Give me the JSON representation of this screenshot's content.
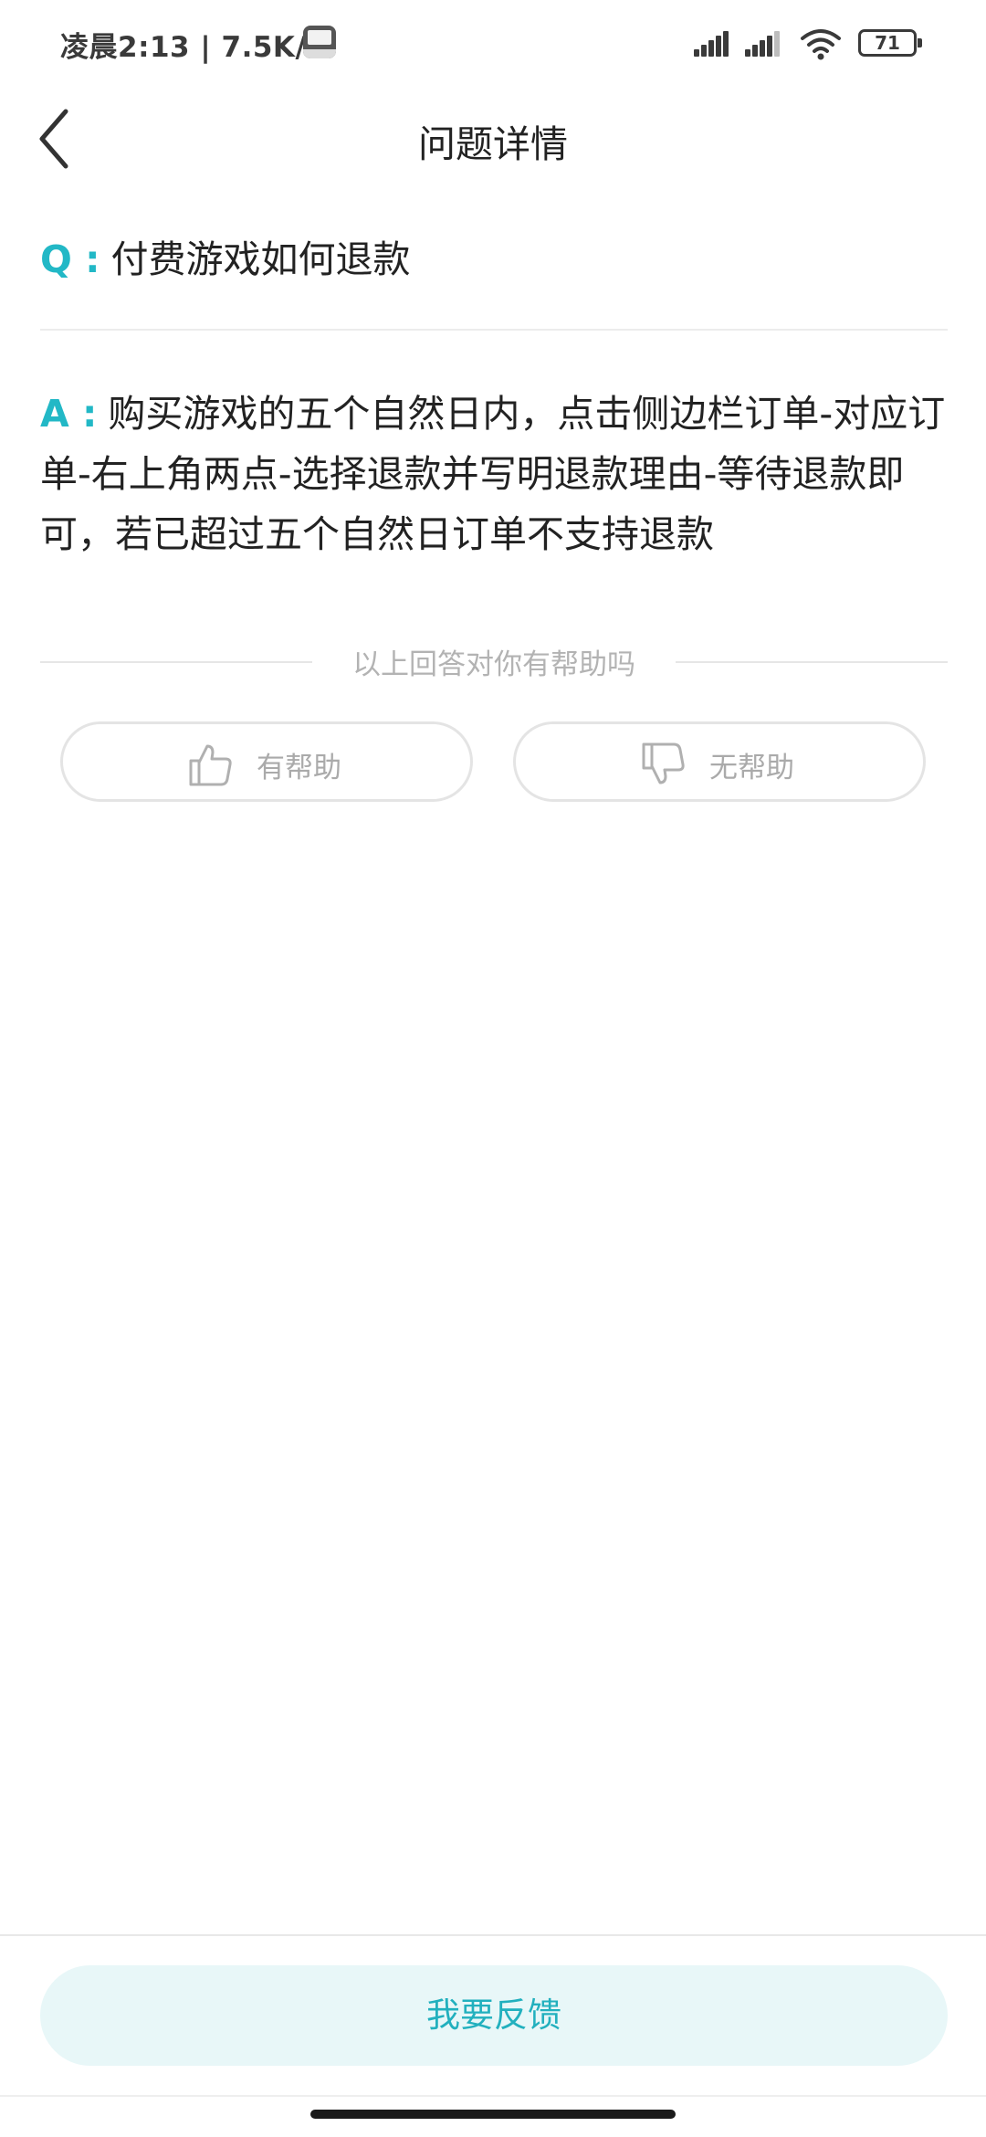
{
  "status_bar": {
    "time_text": "凌晨2:13 | 7.5K/s",
    "battery": "71",
    "icons": [
      "app-notification-icon",
      "signal-icon",
      "signal-icon",
      "wifi-icon",
      "battery-icon"
    ]
  },
  "header": {
    "title": "问题详情",
    "back_icon": "chevron-left-icon"
  },
  "question": {
    "prefix": "Q :",
    "text": "付费游戏如何退款"
  },
  "answer": {
    "prefix": "A :",
    "text": "购买游戏的五个自然日内，点击侧边栏订单-对应订单-右上角两点-选择退款并写明退款理由-等待退款即可，若已超过五个自然日订单不支持退款"
  },
  "helpful": {
    "prompt": "以上回答对你有帮助吗",
    "yes_label": "有帮助",
    "no_label": "无帮助",
    "yes_icon": "thumbs-up-icon",
    "no_icon": "thumbs-down-icon"
  },
  "footer": {
    "feedback_label": "我要反馈"
  },
  "colors": {
    "accent": "#22b8c6",
    "feedback_bg": "#e8f7f8",
    "muted_text": "#aaaaaa"
  }
}
